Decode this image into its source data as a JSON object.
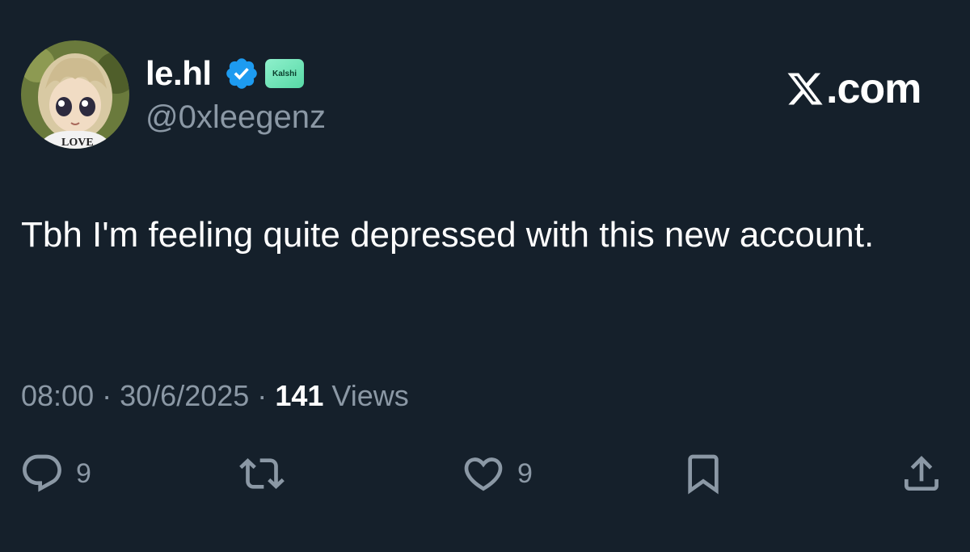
{
  "author": {
    "display_name": "le.hl",
    "handle": "@0xleegenz",
    "verified": true,
    "affiliate_badge": "Kalshi",
    "avatar_shirt_text": "LOVE"
  },
  "site": {
    "logo_icon": "x-logo-icon",
    "text": ".com"
  },
  "tweet": {
    "text": "Tbh I'm feeling quite depressed with this new account.",
    "time": "08:00",
    "date": "30/6/2025",
    "separator": "·",
    "views_count": "141",
    "views_label": "Views"
  },
  "actions": {
    "replies": "9",
    "likes": "9"
  },
  "icons": {
    "reply": "reply-icon",
    "retweet": "retweet-icon",
    "like": "heart-icon",
    "bookmark": "bookmark-icon",
    "share": "share-icon"
  },
  "colors": {
    "background": "#15202b",
    "text_primary": "#ffffff",
    "text_secondary": "#8b98a5",
    "verified_blue": "#1d9bf0",
    "kalshi_green": "#57d9a6"
  }
}
